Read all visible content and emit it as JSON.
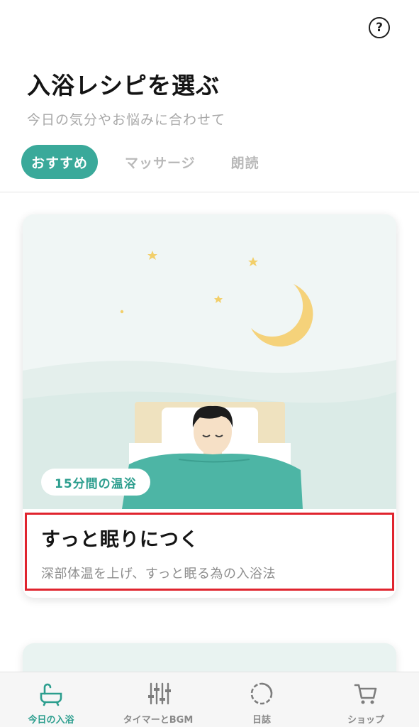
{
  "header": {
    "help_icon": "question-circle-icon",
    "help_glyph": "?",
    "title": "入浴レシピを選ぶ",
    "subtitle": "今日の気分やお悩みに合わせて"
  },
  "tabs": [
    {
      "label": "おすすめ",
      "active": true
    },
    {
      "label": "マッサージ",
      "active": false
    },
    {
      "label": "朗読",
      "active": false
    }
  ],
  "recipe_card": {
    "duration_badge": "15分間の温浴",
    "title": "すっと眠りにつく",
    "description": "深部体温を上げ、すっと眠る為の入浴法"
  },
  "bottom_nav": [
    {
      "label": "今日の入浴",
      "icon": "bathtub-icon",
      "active": true
    },
    {
      "label": "タイマーとBGM",
      "icon": "sliders-icon",
      "active": false
    },
    {
      "label": "日誌",
      "icon": "progress-circle-icon",
      "active": false
    },
    {
      "label": "ショップ",
      "icon": "cart-icon",
      "active": false
    }
  ],
  "colors": {
    "accent": "#3aa99a",
    "highlight": "#e0242e",
    "moon": "#f5d27a",
    "blanket": "#4db5a5"
  }
}
